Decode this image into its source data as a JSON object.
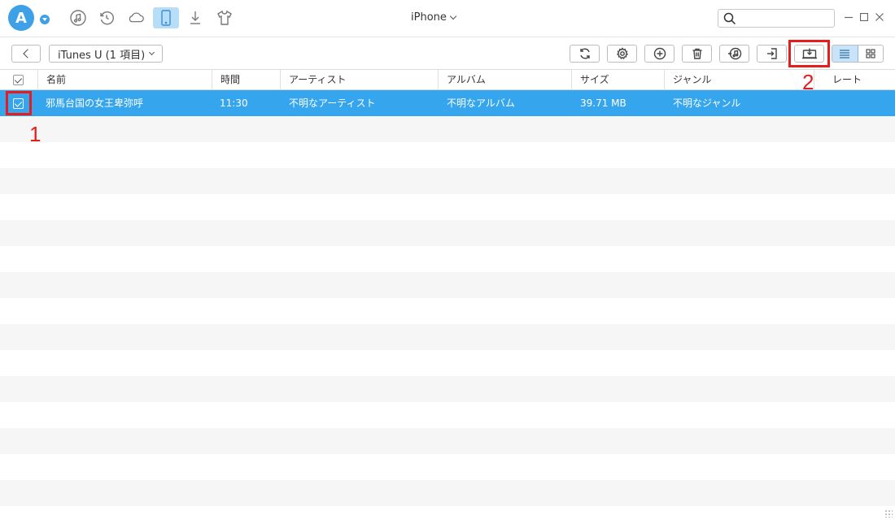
{
  "app": {
    "logo_letter": "A",
    "device_name": "iPhone",
    "search_placeholder": "",
    "nav_icons": [
      "music-icon",
      "restore-icon",
      "cloud-icon",
      "phone-icon",
      "download-icon",
      "shirt-icon"
    ],
    "window_controls": [
      "minimize",
      "maximize",
      "close"
    ]
  },
  "toolbar": {
    "breadcrumb": "iTunes U (1 項目)",
    "buttons": [
      "refresh-icon",
      "settings-icon",
      "add-icon",
      "trash-icon",
      "to-itunes-icon",
      "to-device-icon",
      "export-to-pc-icon"
    ],
    "view_modes": [
      "list",
      "grid"
    ]
  },
  "table": {
    "columns": [
      "名前",
      "時間",
      "アーティスト",
      "アルバム",
      "サイズ",
      "ジャンル",
      "レート"
    ],
    "rows": [
      {
        "selected": true,
        "name": "邪馬台国の女王卑弥呼",
        "time": "11:30",
        "artist": "不明なアーティスト",
        "album": "不明なアルバム",
        "size": "39.71 MB",
        "genre": "不明なジャンル"
      }
    ]
  },
  "annotations": [
    "1",
    "2"
  ],
  "colors": {
    "selection": "#35a6ee",
    "accent": "#3ea0e6",
    "highlight": "#e51d1d"
  }
}
